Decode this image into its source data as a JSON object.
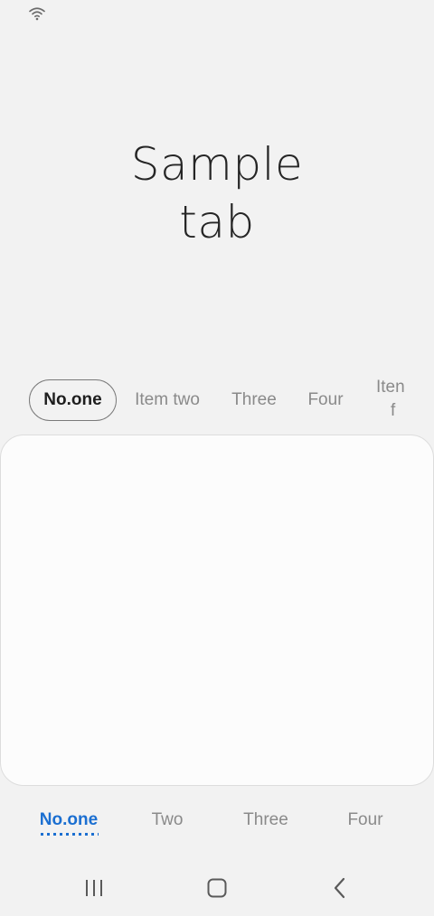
{
  "status_bar": {
    "wifi_icon": "wifi-icon"
  },
  "title": {
    "line1": "Sample",
    "line2": "tab"
  },
  "top_tabs": {
    "items": [
      "No.one",
      "Item two",
      "Three",
      "Four"
    ],
    "partial_item": {
      "line1": "Iten",
      "line2": "f"
    },
    "selected_index": 0
  },
  "bottom_tabs": {
    "items": [
      "No.one",
      "Two",
      "Three",
      "Four"
    ],
    "selected_index": 0,
    "accent_color": "#1b6fd1"
  },
  "nav_bar": {
    "recents_icon": "recents-icon",
    "home_icon": "home-icon",
    "back_icon": "back-icon"
  }
}
